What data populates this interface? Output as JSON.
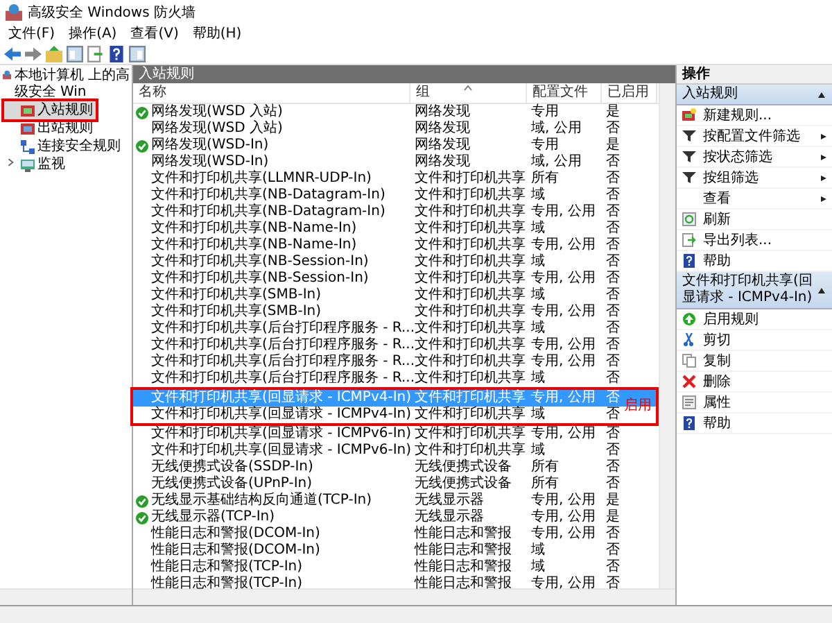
{
  "window": {
    "title": "高级安全 Windows 防火墙"
  },
  "menu": [
    "文件(F)",
    "操作(A)",
    "查看(V)",
    "帮助(H)"
  ],
  "tree": {
    "label": "本地计算机 上的高级安全 Win",
    "children": [
      {
        "label": "入站规则",
        "kind": "inbound",
        "selected": true,
        "highlighted": true,
        "expandable": false
      },
      {
        "label": "出站规则",
        "kind": "outbound",
        "selected": false,
        "highlighted": false,
        "expandable": false
      },
      {
        "label": "连接安全规则",
        "kind": "connection",
        "selected": false,
        "highlighted": false,
        "expandable": false
      },
      {
        "label": "监视",
        "kind": "monitor",
        "selected": false,
        "highlighted": false,
        "expandable": true
      }
    ]
  },
  "table": {
    "title": "入站规则",
    "columns": [
      {
        "label": "名称",
        "sorted": false
      },
      {
        "label": "组",
        "sorted": true
      },
      {
        "label": "配置文件",
        "sorted": false
      },
      {
        "label": "已启用",
        "sorted": false
      }
    ],
    "rows": [
      {
        "cells": [
          "网络发现(WSD 入站)",
          "网络发现",
          "专用",
          "是"
        ],
        "enabled_mark": true,
        "selected": false,
        "highlighted": false
      },
      {
        "cells": [
          "网络发现(WSD 入站)",
          "网络发现",
          "域, 公用",
          "否"
        ],
        "enabled_mark": false,
        "selected": false,
        "highlighted": false
      },
      {
        "cells": [
          "网络发现(WSD-In)",
          "网络发现",
          "专用",
          "是"
        ],
        "enabled_mark": true,
        "selected": false,
        "highlighted": false
      },
      {
        "cells": [
          "网络发现(WSD-In)",
          "网络发现",
          "域, 公用",
          "否"
        ],
        "enabled_mark": false,
        "selected": false,
        "highlighted": false
      },
      {
        "cells": [
          "文件和打印机共享(LLMNR-UDP-In)",
          "文件和打印机共享",
          "所有",
          "否"
        ],
        "enabled_mark": false,
        "selected": false,
        "highlighted": false
      },
      {
        "cells": [
          "文件和打印机共享(NB-Datagram-In)",
          "文件和打印机共享",
          "域",
          "否"
        ],
        "enabled_mark": false,
        "selected": false,
        "highlighted": false
      },
      {
        "cells": [
          "文件和打印机共享(NB-Datagram-In)",
          "文件和打印机共享",
          "专用, 公用",
          "否"
        ],
        "enabled_mark": false,
        "selected": false,
        "highlighted": false
      },
      {
        "cells": [
          "文件和打印机共享(NB-Name-In)",
          "文件和打印机共享",
          "域",
          "否"
        ],
        "enabled_mark": false,
        "selected": false,
        "highlighted": false
      },
      {
        "cells": [
          "文件和打印机共享(NB-Name-In)",
          "文件和打印机共享",
          "专用, 公用",
          "否"
        ],
        "enabled_mark": false,
        "selected": false,
        "highlighted": false
      },
      {
        "cells": [
          "文件和打印机共享(NB-Session-In)",
          "文件和打印机共享",
          "域",
          "否"
        ],
        "enabled_mark": false,
        "selected": false,
        "highlighted": false
      },
      {
        "cells": [
          "文件和打印机共享(NB-Session-In)",
          "文件和打印机共享",
          "专用, 公用",
          "否"
        ],
        "enabled_mark": false,
        "selected": false,
        "highlighted": false
      },
      {
        "cells": [
          "文件和打印机共享(SMB-In)",
          "文件和打印机共享",
          "域",
          "否"
        ],
        "enabled_mark": false,
        "selected": false,
        "highlighted": false
      },
      {
        "cells": [
          "文件和打印机共享(SMB-In)",
          "文件和打印机共享",
          "专用, 公用",
          "否"
        ],
        "enabled_mark": false,
        "selected": false,
        "highlighted": false
      },
      {
        "cells": [
          "文件和打印机共享(后台打印程序服务 - R...",
          "文件和打印机共享",
          "域",
          "否"
        ],
        "enabled_mark": false,
        "selected": false,
        "highlighted": false
      },
      {
        "cells": [
          "文件和打印机共享(后台打印程序服务 - R...",
          "文件和打印机共享",
          "专用, 公用",
          "否"
        ],
        "enabled_mark": false,
        "selected": false,
        "highlighted": false
      },
      {
        "cells": [
          "文件和打印机共享(后台打印程序服务 - R...",
          "文件和打印机共享",
          "专用, 公用",
          "否"
        ],
        "enabled_mark": false,
        "selected": false,
        "highlighted": false
      },
      {
        "cells": [
          "文件和打印机共享(后台打印程序服务 - R...",
          "文件和打印机共享",
          "域",
          "否"
        ],
        "enabled_mark": false,
        "selected": false,
        "highlighted": false
      },
      {
        "cells": [
          "文件和打印机共享(回显请求 - ICMPv4-In)",
          "文件和打印机共享",
          "专用, 公用",
          "否"
        ],
        "enabled_mark": false,
        "selected": true,
        "highlighted": true
      },
      {
        "cells": [
          "文件和打印机共享(回显请求 - ICMPv4-In)",
          "文件和打印机共享",
          "域",
          "否"
        ],
        "enabled_mark": false,
        "selected": false,
        "highlighted": true
      },
      {
        "cells": [
          "文件和打印机共享(回显请求 - ICMPv6-In)",
          "文件和打印机共享",
          "专用, 公用",
          "否"
        ],
        "enabled_mark": false,
        "selected": false,
        "highlighted": false
      },
      {
        "cells": [
          "文件和打印机共享(回显请求 - ICMPv6-In)",
          "文件和打印机共享",
          "域",
          "否"
        ],
        "enabled_mark": false,
        "selected": false,
        "highlighted": false
      },
      {
        "cells": [
          "无线便携式设备(SSDP-In)",
          "无线便携式设备",
          "所有",
          "否"
        ],
        "enabled_mark": false,
        "selected": false,
        "highlighted": false
      },
      {
        "cells": [
          "无线便携式设备(UPnP-In)",
          "无线便携式设备",
          "所有",
          "否"
        ],
        "enabled_mark": false,
        "selected": false,
        "highlighted": false
      },
      {
        "cells": [
          "无线显示基础结构反向通道(TCP-In)",
          "无线显示器",
          "专用, 公用",
          "是"
        ],
        "enabled_mark": true,
        "selected": false,
        "highlighted": false
      },
      {
        "cells": [
          "无线显示器(TCP-In)",
          "无线显示器",
          "专用, 公用",
          "是"
        ],
        "enabled_mark": true,
        "selected": false,
        "highlighted": false
      },
      {
        "cells": [
          "性能日志和警报(DCOM-In)",
          "性能日志和警报",
          "专用, 公用",
          "否"
        ],
        "enabled_mark": false,
        "selected": false,
        "highlighted": false
      },
      {
        "cells": [
          "性能日志和警报(DCOM-In)",
          "性能日志和警报",
          "域",
          "否"
        ],
        "enabled_mark": false,
        "selected": false,
        "highlighted": false
      },
      {
        "cells": [
          "性能日志和警报(TCP-In)",
          "性能日志和警报",
          "域",
          "否"
        ],
        "enabled_mark": false,
        "selected": false,
        "highlighted": false
      },
      {
        "cells": [
          "性能日志和警报(TCP-In)",
          "性能日志和警报",
          "专用, 公用",
          "否"
        ],
        "enabled_mark": false,
        "selected": false,
        "highlighted": false
      }
    ],
    "annotation": "启用"
  },
  "actions": {
    "title": "操作",
    "sections": [
      {
        "title": "入站规则",
        "expanded": true,
        "items": [
          {
            "label": "新建规则...",
            "kind": "new-rule",
            "submenu": false
          },
          {
            "label": "按配置文件筛选",
            "kind": "filter",
            "submenu": true
          },
          {
            "label": "按状态筛选",
            "kind": "filter",
            "submenu": true
          },
          {
            "label": "按组筛选",
            "kind": "filter",
            "submenu": true
          },
          {
            "label": "查看",
            "kind": "none",
            "submenu": true
          },
          {
            "label": "刷新",
            "kind": "refresh",
            "submenu": false
          },
          {
            "label": "导出列表...",
            "kind": "export",
            "submenu": false
          },
          {
            "label": "帮助",
            "kind": "help",
            "submenu": false
          }
        ]
      },
      {
        "title": "文件和打印机共享(回显请求 - ICMPv4-In)",
        "expanded": true,
        "items": [
          {
            "label": "启用规则",
            "kind": "enable",
            "submenu": false
          },
          {
            "label": "剪切",
            "kind": "cut",
            "submenu": false
          },
          {
            "label": "复制",
            "kind": "copy",
            "submenu": false
          },
          {
            "label": "删除",
            "kind": "delete",
            "submenu": false
          },
          {
            "label": "属性",
            "kind": "properties",
            "submenu": false
          },
          {
            "label": "帮助",
            "kind": "help",
            "submenu": false
          }
        ]
      }
    ]
  }
}
